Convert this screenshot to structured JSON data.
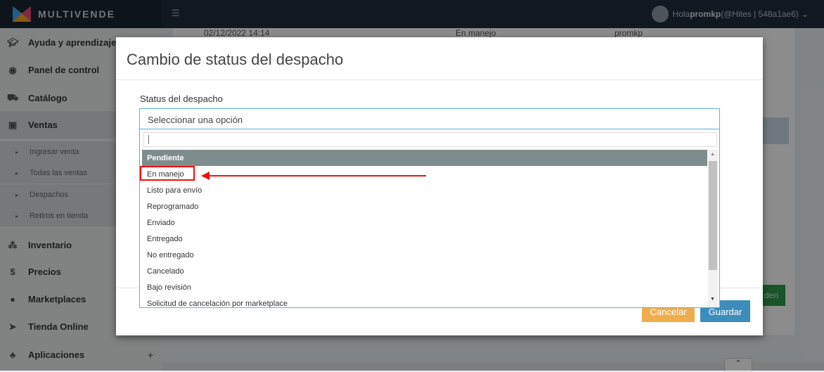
{
  "brand": {
    "name": "MULTIVENDE"
  },
  "user": {
    "greeting": "Hola ",
    "username": "promkp",
    "account": " (@Hites | 548a1ae6)"
  },
  "sidebar": {
    "items": [
      {
        "label": "Ayuda y aprendizaje",
        "icon": "graduation-cap-icon"
      },
      {
        "label": "Panel de control",
        "icon": "dashboard-icon"
      },
      {
        "label": "Catálogo",
        "icon": "cart-icon"
      },
      {
        "label": "Ventas",
        "icon": "money-icon"
      },
      {
        "label": "Inventario",
        "icon": "cubes-icon"
      },
      {
        "label": "Precios",
        "icon": "dollar-icon"
      },
      {
        "label": "Marketplaces",
        "icon": "globe-icon"
      },
      {
        "label": "Tienda Online",
        "icon": "cursor-icon"
      },
      {
        "label": "Aplicaciones",
        "icon": "sitemap-icon"
      }
    ],
    "sub_items": [
      "Ingresar venta",
      "Todas las ventas",
      "Despachos",
      "Retiros en tienda"
    ],
    "plus": "+"
  },
  "background": {
    "row_date": "02/12/2022 14:14",
    "row_status": "En manejo",
    "row_user": "promkp",
    "green_button_partial": "den"
  },
  "modal": {
    "title": "Cambio de status del despacho",
    "field_label": "Status del despacho",
    "select_placeholder": "Seleccionar una opción",
    "options": [
      "Pendiente",
      "En manejo",
      "Listo para envío",
      "Reprogramado",
      "Enviado",
      "Entregado",
      "No entregado",
      "Cancelado",
      "Bajo revisión",
      "Solicitud de cancelación por marketplace"
    ],
    "highlighted_index": 0,
    "cancel_label": "Cancelar",
    "save_label": "Guardar"
  },
  "colors": {
    "accent": "#3c8dbc",
    "warning": "#f0ad4e",
    "annotation": "#e11111",
    "highlight": "#7f8c8d"
  }
}
